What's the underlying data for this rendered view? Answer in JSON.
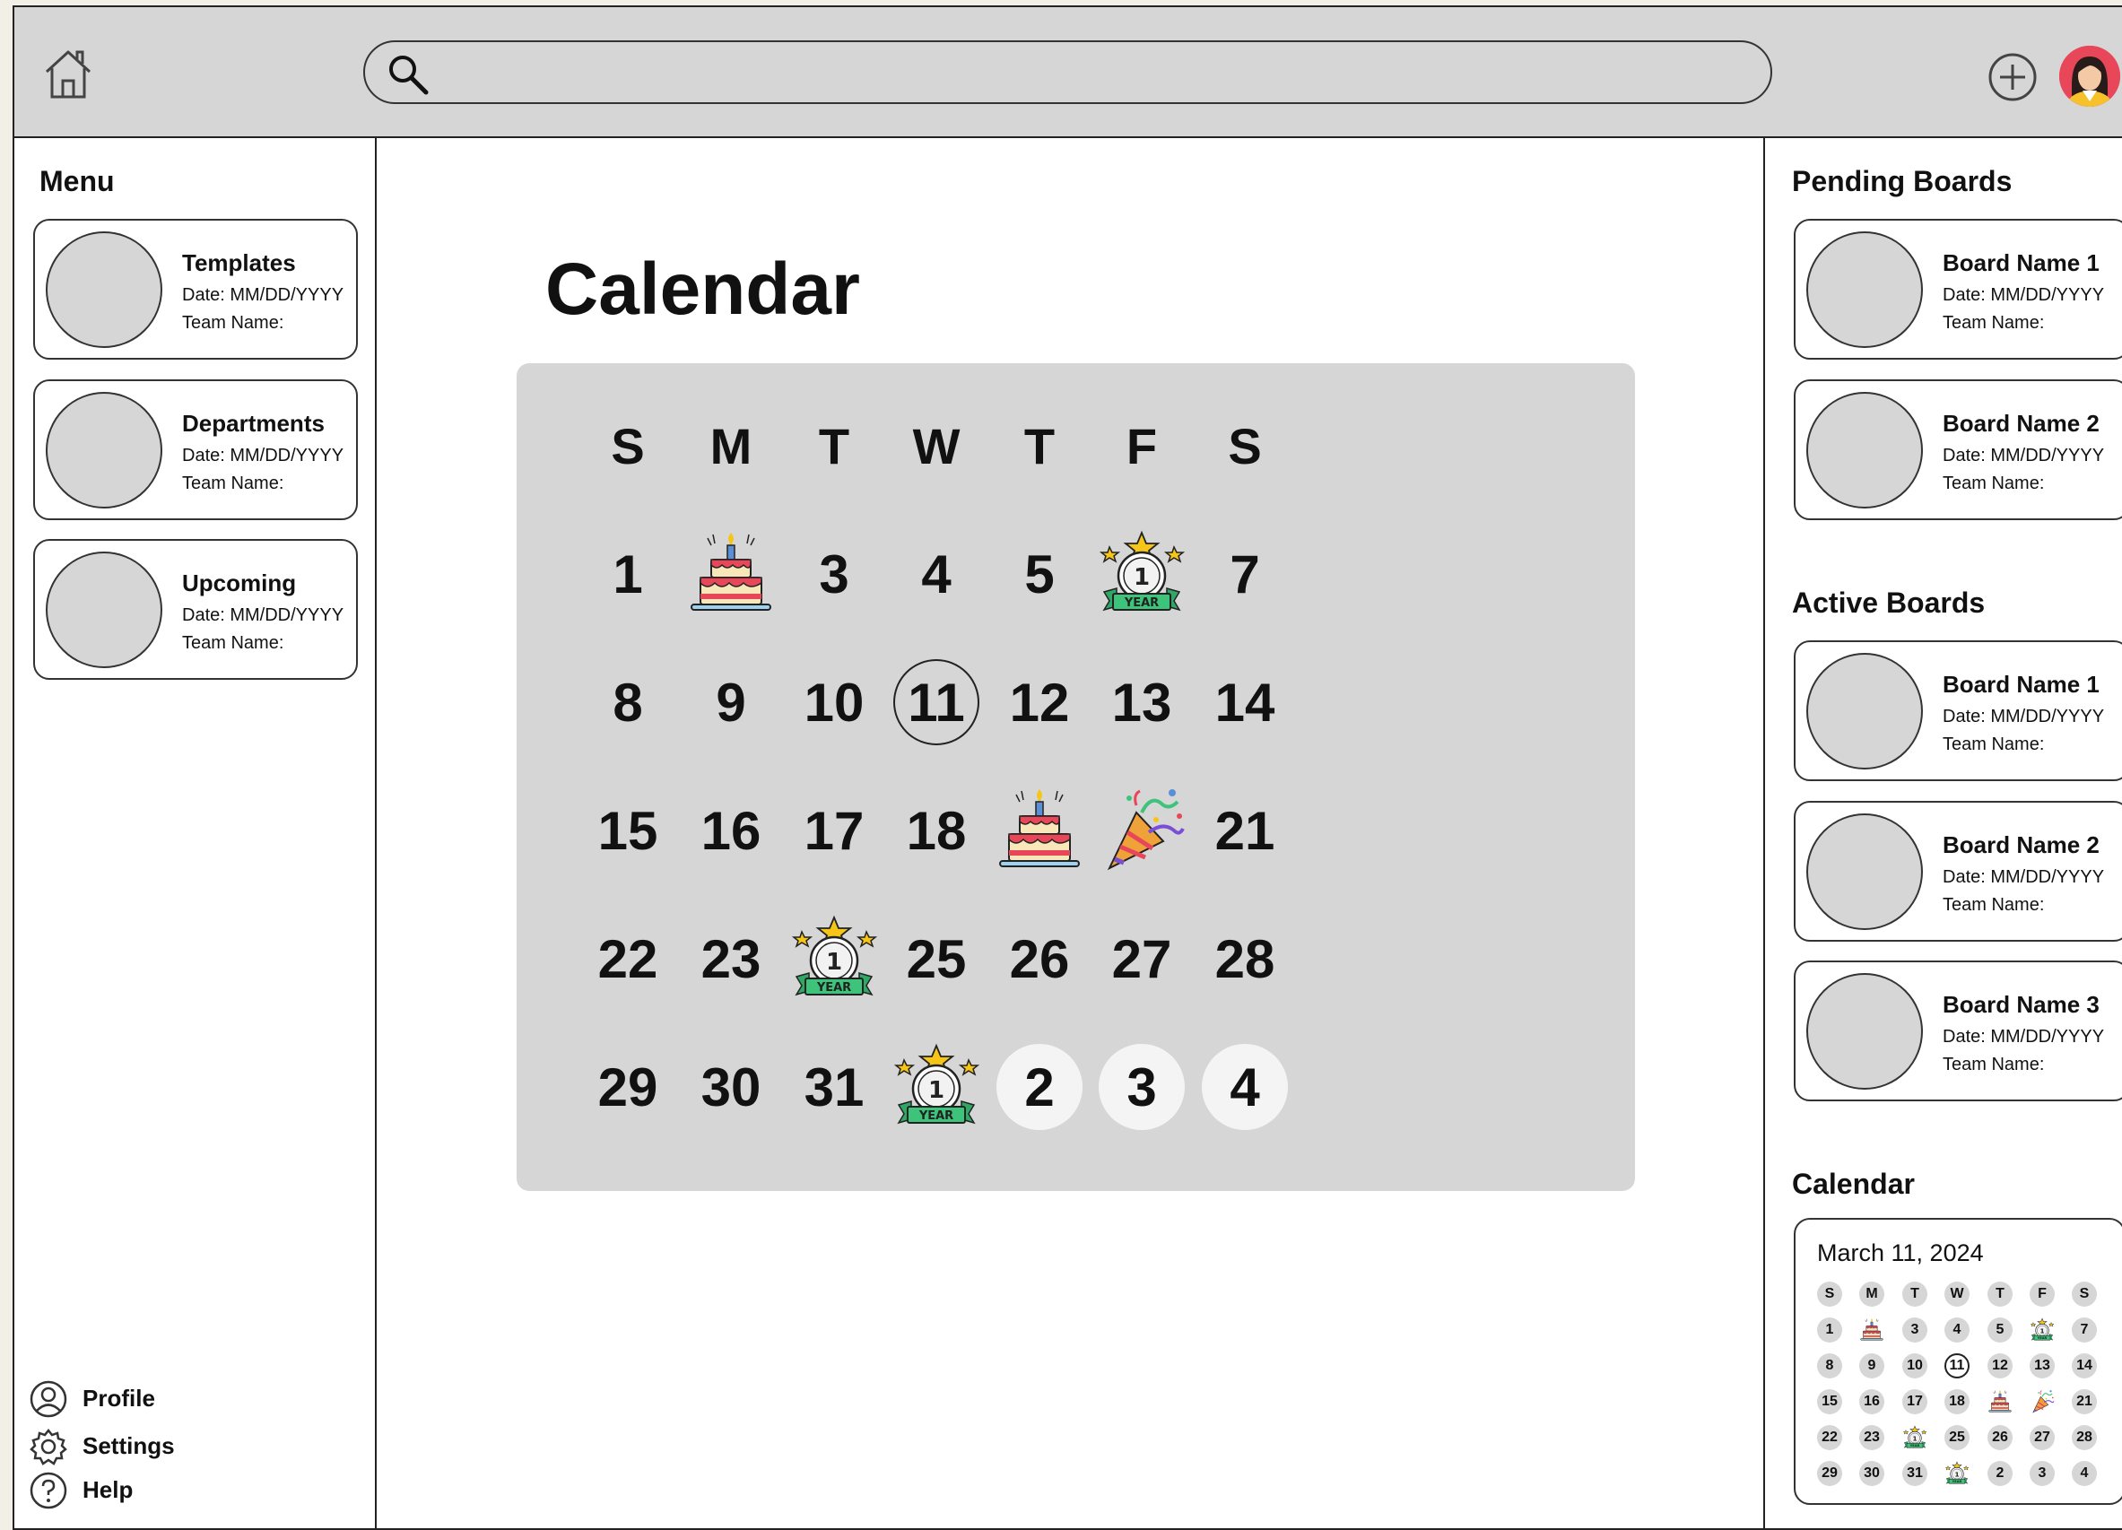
{
  "search": {
    "placeholder": ""
  },
  "menu": {
    "title": "Menu",
    "cards": [
      {
        "title": "Templates",
        "date": "Date: MM/DD/YYYY",
        "team": "Team Name:"
      },
      {
        "title": "Departments",
        "date": "Date: MM/DD/YYYY",
        "team": "Team Name:"
      },
      {
        "title": "Upcoming",
        "date": "Date: MM/DD/YYYY",
        "team": "Team Name:"
      }
    ],
    "links": [
      {
        "label": "Profile",
        "icon": "profile-icon"
      },
      {
        "label": "Settings",
        "icon": "gear-icon"
      },
      {
        "label": "Help",
        "icon": "help-icon"
      }
    ]
  },
  "main": {
    "title": "Calendar",
    "weekdays": [
      "S",
      "M",
      "T",
      "W",
      "T",
      "F",
      "S"
    ],
    "today": "11",
    "weeks": [
      [
        "1",
        "icon:cake",
        "3",
        "4",
        "5",
        "icon:anniversary",
        "7"
      ],
      [
        "8",
        "9",
        "10",
        "11",
        "12",
        "13",
        "14"
      ],
      [
        "15",
        "16",
        "17",
        "18",
        "icon:cake",
        "icon:party",
        "21"
      ],
      [
        "22",
        "23",
        "icon:anniversary",
        "25",
        "26",
        "27",
        "28"
      ],
      [
        "29",
        "30",
        "31",
        "icon:anniversary",
        "next:2",
        "next:3",
        "next:4"
      ]
    ]
  },
  "pending": {
    "title": "Pending Boards",
    "cards": [
      {
        "title": "Board Name 1",
        "date": "Date: MM/DD/YYYY",
        "team": "Team Name:"
      },
      {
        "title": "Board Name 2",
        "date": "Date: MM/DD/YYYY",
        "team": "Team Name:"
      }
    ]
  },
  "active": {
    "title": "Active Boards",
    "cards": [
      {
        "title": "Board Name 1",
        "date": "Date: MM/DD/YYYY",
        "team": "Team Name:"
      },
      {
        "title": "Board Name 2",
        "date": "Date: MM/DD/YYYY",
        "team": "Team Name:"
      },
      {
        "title": "Board Name 3",
        "date": "Date: MM/DD/YYYY",
        "team": "Team Name:"
      }
    ]
  },
  "mini_calendar": {
    "title": "Calendar",
    "date": "March 11, 2024"
  },
  "icons": {
    "cake": "birthday-cake-icon",
    "anniversary": "one-year-anniversary-badge-icon",
    "party": "party-popper-icon"
  },
  "colors": {
    "panel_gray": "#d6d6d6",
    "avatar_bg": "#e8475a",
    "banner_green": "#3dc47a",
    "star_yellow": "#f5c518",
    "cake_red": "#e8475a"
  }
}
